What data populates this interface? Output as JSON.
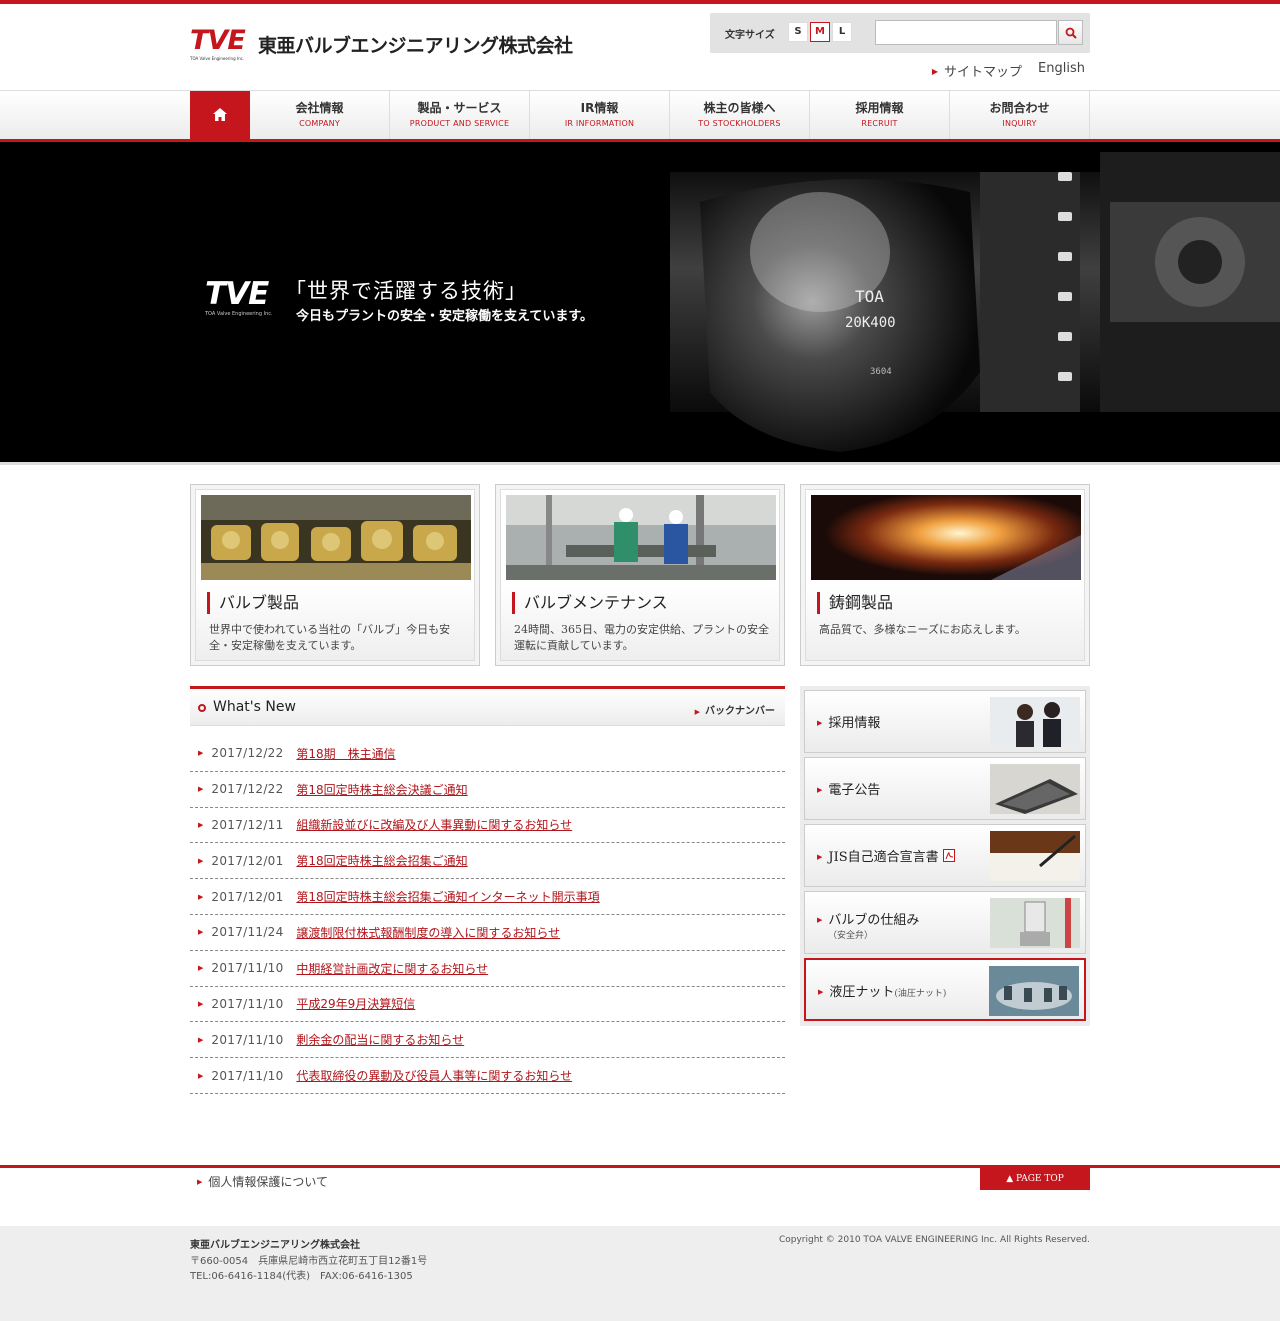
{
  "header": {
    "logo_mark": "TVE",
    "logo_sub": "TOA Valve Engineering Inc.",
    "company_name": "東亜バルブエンジニアリング株式会社",
    "font_size_label": "文字サイズ",
    "font_sizes": [
      "S",
      "M",
      "L"
    ],
    "font_size_selected": "M",
    "search_placeholder": "",
    "sitemap_label": "サイトマップ",
    "english_label": "English"
  },
  "nav": {
    "home_icon": "home-icon",
    "items": [
      {
        "jp": "会社情報",
        "en": "COMPANY"
      },
      {
        "jp": "製品・サービス",
        "en": "PRODUCT AND SERVICE"
      },
      {
        "jp": "IR情報",
        "en": "IR INFORMATION"
      },
      {
        "jp": "株主の皆様へ",
        "en": "TO STOCKHOLDERS"
      },
      {
        "jp": "採用情報",
        "en": "RECRUIT"
      },
      {
        "jp": "お問合わせ",
        "en": "INQUIRY"
      }
    ]
  },
  "hero": {
    "logo_mark": "TVE",
    "logo_sub": "TOA Valve Engineering Inc.",
    "title": "「世界で活躍する技術」",
    "subtitle": "今日もプラントの安全・安定稼働を支えています。",
    "valve_marks": [
      "TOA",
      "20K400",
      "3604"
    ]
  },
  "cards": [
    {
      "title": "バルブ製品",
      "desc": "世界中で使われている当社の「バルブ」今日も安全・安定稼働を支えています。"
    },
    {
      "title": "バルブメンテナンス",
      "desc": "24時間、365日、電力の安定供給、プラントの安全運転に貢献しています。"
    },
    {
      "title": "鋳鋼製品",
      "desc": "高品質で、多様なニーズにお応えします。"
    }
  ],
  "news": {
    "title": "What's New",
    "back_number": "バックナンバー",
    "items": [
      {
        "date": "2017/12/22",
        "text": "第18期　株主通信"
      },
      {
        "date": "2017/12/22",
        "text": "第18回定時株主総会決議ご通知"
      },
      {
        "date": "2017/12/11",
        "text": "組織新設並びに改編及び人事異動に関するお知らせ"
      },
      {
        "date": "2017/12/01",
        "text": "第18回定時株主総会招集ご通知"
      },
      {
        "date": "2017/12/01",
        "text": "第18回定時株主総会招集ご通知インターネット開示事項"
      },
      {
        "date": "2017/11/24",
        "text": "譲渡制限付株式報酬制度の導入に関するお知らせ"
      },
      {
        "date": "2017/11/10",
        "text": "中期経営計画改定に関するお知らせ"
      },
      {
        "date": "2017/11/10",
        "text": "平成29年9月決算短信"
      },
      {
        "date": "2017/11/10",
        "text": "剰余金の配当に関するお知らせ"
      },
      {
        "date": "2017/11/10",
        "text": "代表取締役の異動及び役員人事等に関するお知らせ"
      }
    ]
  },
  "side": {
    "banners": [
      {
        "label": "採用情報",
        "sub": "",
        "small": ""
      },
      {
        "label": "電子公告",
        "sub": "",
        "small": ""
      },
      {
        "label": "JIS自己適合宣言書",
        "sub": "",
        "small": ""
      },
      {
        "label": "バルブの仕組み",
        "sub": "（安全弁）",
        "small": ""
      },
      {
        "label": "液圧ナット",
        "sub": "",
        "small": "(油圧ナット)"
      }
    ]
  },
  "footer": {
    "privacy": "個人情報保護について",
    "page_top": "▲ PAGE TOP",
    "company": "東亜バルブエンジニアリング株式会社",
    "address": "〒660-0054　兵庫県尼崎市西立花町五丁目12番1号",
    "tel": "TEL:06-6416-1184(代表)　FAX:06-6416-1305",
    "copyright": "Copyright © 2010 TOA VALVE ENGINEERING Inc. All Rights Reserved."
  },
  "colors": {
    "accent": "#c4161c",
    "footer_bg": "#eeeeee",
    "hero_bg": "#000000"
  }
}
